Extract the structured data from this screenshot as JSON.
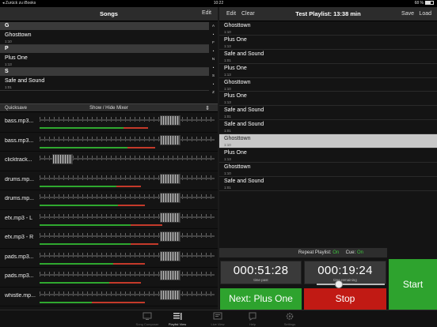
{
  "status_bar": {
    "back_app": "Zurück zu iBooks",
    "time": "10:22",
    "battery": "68 %"
  },
  "songs_panel": {
    "title": "Songs",
    "edit_label": "Edit",
    "sections": [
      {
        "letter": "G",
        "songs": [
          {
            "name": "Ghosttown",
            "duration": "1:10"
          }
        ]
      },
      {
        "letter": "P",
        "songs": [
          {
            "name": "Plus One",
            "duration": "1:13"
          }
        ]
      },
      {
        "letter": "S",
        "songs": [
          {
            "name": "Safe and Sound",
            "duration": "1:01"
          }
        ]
      }
    ],
    "index": [
      "A",
      "•",
      "F",
      "•",
      "N",
      "•",
      "S",
      "•",
      "Z"
    ]
  },
  "mixer": {
    "quicksave_label": "Quicksave",
    "toggle_label": "Show / Hide Mixer",
    "tracks": [
      {
        "name": "bass.mp3...",
        "volume": 0.78,
        "green": 0.48,
        "red": 0.62
      },
      {
        "name": "bass.mp3...",
        "volume": 0.78,
        "green": 0.5,
        "red": 0.66
      },
      {
        "name": "clicktrack...",
        "volume": 0.08,
        "green": 0.0,
        "red": 0.0
      },
      {
        "name": "drums.mp...",
        "volume": 0.78,
        "green": 0.44,
        "red": 0.58
      },
      {
        "name": "drums.mp...",
        "volume": 0.78,
        "green": 0.45,
        "red": 0.6
      },
      {
        "name": "efx.mp3 - L",
        "volume": 0.78,
        "green": 0.52,
        "red": 0.7
      },
      {
        "name": "efx.mp3 - R",
        "volume": 0.78,
        "green": 0.52,
        "red": 0.68
      },
      {
        "name": "pads.mp3...",
        "volume": 0.78,
        "green": 0.42,
        "red": 0.6
      },
      {
        "name": "pads.mp3...",
        "volume": 0.78,
        "green": 0.4,
        "red": 0.58
      },
      {
        "name": "whistle.mp...",
        "volume": 0.78,
        "green": 0.3,
        "red": 0.6
      }
    ]
  },
  "playlist": {
    "edit_label": "Edit",
    "clear_label": "Clear",
    "title": "Test Playlist:  13:38 min",
    "save_label": "Save",
    "load_label": "Load",
    "items": [
      {
        "name": "Ghosttown",
        "duration": "1:10",
        "active": false
      },
      {
        "name": "Plus One",
        "duration": "1:13",
        "active": false
      },
      {
        "name": "Safe and Sound",
        "duration": "1:01",
        "active": false
      },
      {
        "name": "Plus One",
        "duration": "1:13",
        "active": false
      },
      {
        "name": "Ghosttown",
        "duration": "1:10",
        "active": false
      },
      {
        "name": "Plus One",
        "duration": "1:13",
        "active": false
      },
      {
        "name": "Safe and Sound",
        "duration": "1:01",
        "active": false
      },
      {
        "name": "Safe and Sound",
        "duration": "1:01",
        "active": false
      },
      {
        "name": "Ghosttown",
        "duration": "1:10",
        "active": true
      },
      {
        "name": "Plus One",
        "duration": "1:13",
        "active": false
      },
      {
        "name": "Ghosttown",
        "duration": "1:10",
        "active": false
      },
      {
        "name": "Safe and Sound",
        "duration": "1:01",
        "active": false
      }
    ]
  },
  "transport": {
    "repeat_label": "Repeat Playlist:",
    "repeat_value": "On",
    "cue_label": "Cue:",
    "cue_value": "On",
    "time_past": "000:51:28",
    "time_past_label": "time past",
    "time_remaining": "000:19:24",
    "time_remaining_label": "time remaining",
    "next_label": "Next: Plus One",
    "stop_label": "Stop",
    "start_label": "Start"
  },
  "tabbar": {
    "tabs": [
      {
        "label": "Song Composer",
        "icon": "monitor-icon",
        "active": false
      },
      {
        "label": "Playlist View",
        "icon": "playlist-icon",
        "active": true
      },
      {
        "label": "Live View",
        "icon": "live-view-icon",
        "active": false
      },
      {
        "label": "Help",
        "icon": "help-icon",
        "active": false
      },
      {
        "label": "Settings",
        "icon": "gear-icon",
        "active": false
      }
    ]
  },
  "colors": {
    "green": "#2ea32e",
    "red": "#c11a14",
    "on_text": "#3ec43e"
  }
}
